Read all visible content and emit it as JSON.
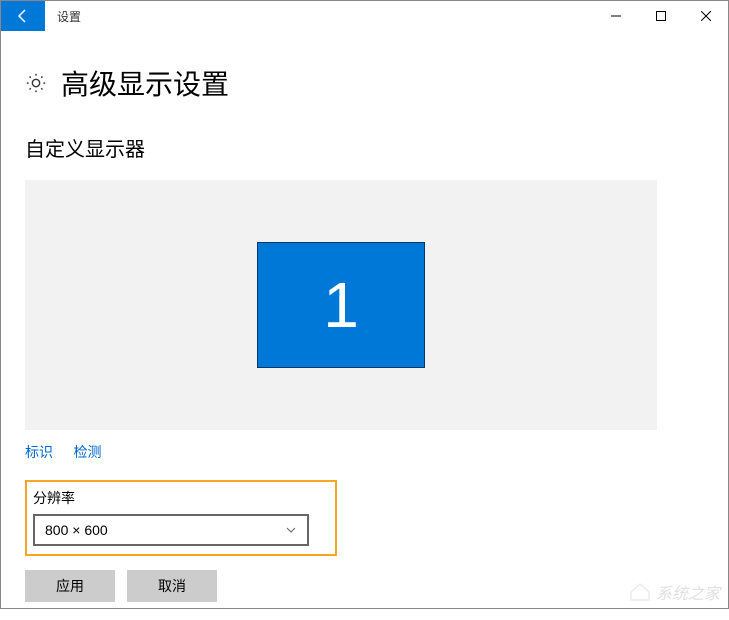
{
  "titlebar": {
    "title": "设置"
  },
  "header": {
    "title": "高级显示设置"
  },
  "section": {
    "title": "自定义显示器"
  },
  "monitor": {
    "number": "1"
  },
  "links": {
    "identify": "标识",
    "detect": "检测"
  },
  "resolution": {
    "label": "分辨率",
    "value": "800 × 600"
  },
  "buttons": {
    "apply": "应用",
    "cancel": "取消"
  },
  "watermark": {
    "text": "系统之家"
  }
}
